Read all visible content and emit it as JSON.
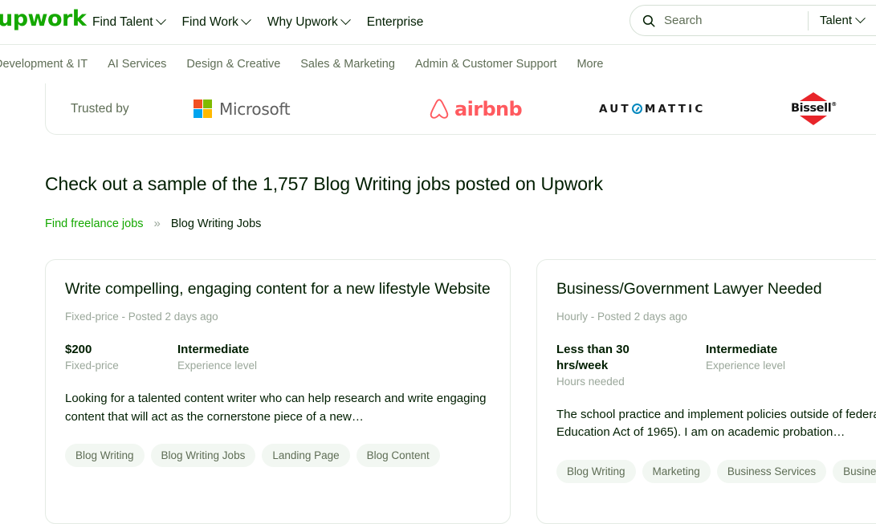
{
  "brand": {
    "logo_text": "upwork",
    "green": "#14a800"
  },
  "header": {
    "nav": [
      {
        "label": "Find Talent",
        "has_caret": true
      },
      {
        "label": "Find Work",
        "has_caret": true
      },
      {
        "label": "Why Upwork",
        "has_caret": true
      },
      {
        "label": "Enterprise",
        "has_caret": false
      }
    ],
    "search": {
      "placeholder": "Search",
      "value": "",
      "type_label": "Talent"
    }
  },
  "subnav": {
    "items": [
      "Development & IT",
      "AI Services",
      "Design & Creative",
      "Sales & Marketing",
      "Admin & Customer Support",
      "More"
    ]
  },
  "trusted_by": {
    "label": "Trusted by",
    "logos": [
      {
        "name": "Microsoft",
        "text": "Microsoft",
        "colors": [
          "#f25022",
          "#7fba00",
          "#00a4ef",
          "#ffb900"
        ]
      },
      {
        "name": "airbnb",
        "text": "airbnb",
        "color": "#ff5a5f"
      },
      {
        "name": "Automattic",
        "text_before": "AUT",
        "text_after": "MATTIC",
        "color": "#0087be"
      },
      {
        "name": "BISSELL",
        "text": "Bissell",
        "color": "#e8252a"
      }
    ]
  },
  "page": {
    "title": "Check out a sample of the 1,757 Blog Writing jobs posted on Upwork",
    "breadcrumb": {
      "link": "Find freelance jobs",
      "separator": "»",
      "current": "Blog Writing Jobs"
    }
  },
  "jobs": [
    {
      "title": "Write compelling, engaging content for a new lifestyle Website",
      "meta": "Fixed-price - Posted 2 days ago",
      "facts": [
        {
          "value": "$200",
          "label": "Fixed-price"
        },
        {
          "value": "Intermediate",
          "label": "Experience level"
        }
      ],
      "description": "Looking for a talented content writer who can help research and write engaging content that will act as the cornerstone piece of a new…",
      "tags": [
        "Blog Writing",
        "Blog Writing Jobs",
        "Landing Page",
        "Blog Content"
      ]
    },
    {
      "title": "Business/Government Lawyer Needed",
      "meta": "Hourly - Posted 2 days ago",
      "facts": [
        {
          "value": "Less than 30 hrs/week",
          "label": "Hours needed"
        },
        {
          "value": "Intermediate",
          "label": "Experience level"
        }
      ],
      "description": "The school practice and implement policies outside of federal law (Higher Education Act of 1965). I am on academic probation…",
      "tags": [
        "Blog Writing",
        "Marketing",
        "Business Services",
        "Business"
      ]
    }
  ]
}
